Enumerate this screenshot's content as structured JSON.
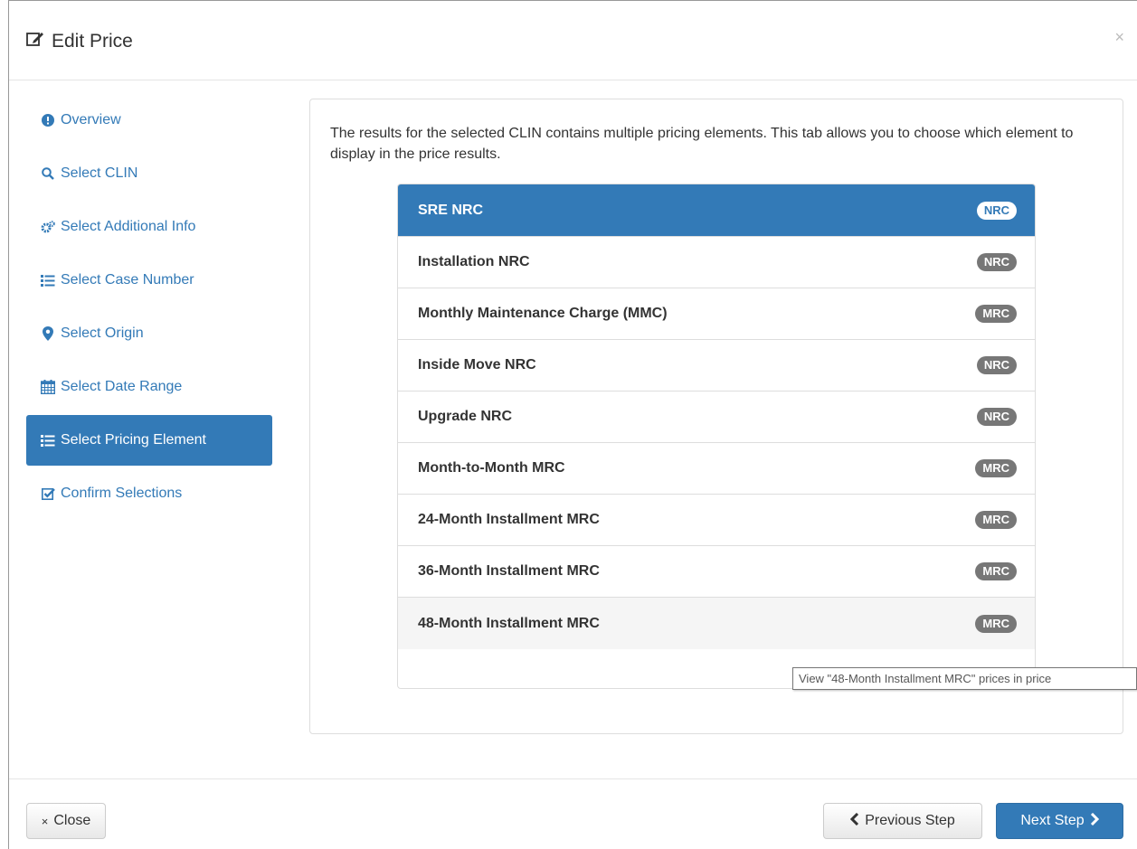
{
  "header": {
    "title": "Edit Price",
    "close_symbol": "×"
  },
  "sidebar": {
    "items": [
      {
        "label": "Overview",
        "icon": "exclamation-circle-icon"
      },
      {
        "label": "Select CLIN",
        "icon": "search-icon"
      },
      {
        "label": "Select Additional Info",
        "icon": "cogs-icon"
      },
      {
        "label": "Select Case Number",
        "icon": "list-icon"
      },
      {
        "label": "Select Origin",
        "icon": "map-marker-icon"
      },
      {
        "label": "Select Date Range",
        "icon": "calendar-icon"
      },
      {
        "label": "Select Pricing Element",
        "icon": "list-icon",
        "active": true
      },
      {
        "label": "Confirm Selections",
        "icon": "check-square-icon"
      }
    ]
  },
  "main": {
    "description": "The results for the selected CLIN contains multiple pricing elements. This tab allows you to choose which element to display in the price results.",
    "elements": [
      {
        "label": "SRE NRC",
        "badge": "NRC",
        "state": "active"
      },
      {
        "label": "Installation NRC",
        "badge": "NRC"
      },
      {
        "label": "Monthly Maintenance Charge (MMC)",
        "badge": "MRC"
      },
      {
        "label": "Inside Move NRC",
        "badge": "NRC"
      },
      {
        "label": "Upgrade NRC",
        "badge": "NRC"
      },
      {
        "label": "Month-to-Month MRC",
        "badge": "MRC"
      },
      {
        "label": "24-Month Installment MRC",
        "badge": "MRC"
      },
      {
        "label": "36-Month Installment MRC",
        "badge": "MRC"
      },
      {
        "label": "48-Month Installment MRC",
        "badge": "MRC",
        "state": "hover"
      }
    ],
    "tooltip": "View \"48-Month Installment MRC\" prices in price"
  },
  "footer": {
    "close_label": "Close",
    "prev_label": "Previous Step",
    "next_label": "Next Step"
  },
  "colors": {
    "primary": "#337ab7",
    "badge": "#777777",
    "link": "#337ab7"
  }
}
